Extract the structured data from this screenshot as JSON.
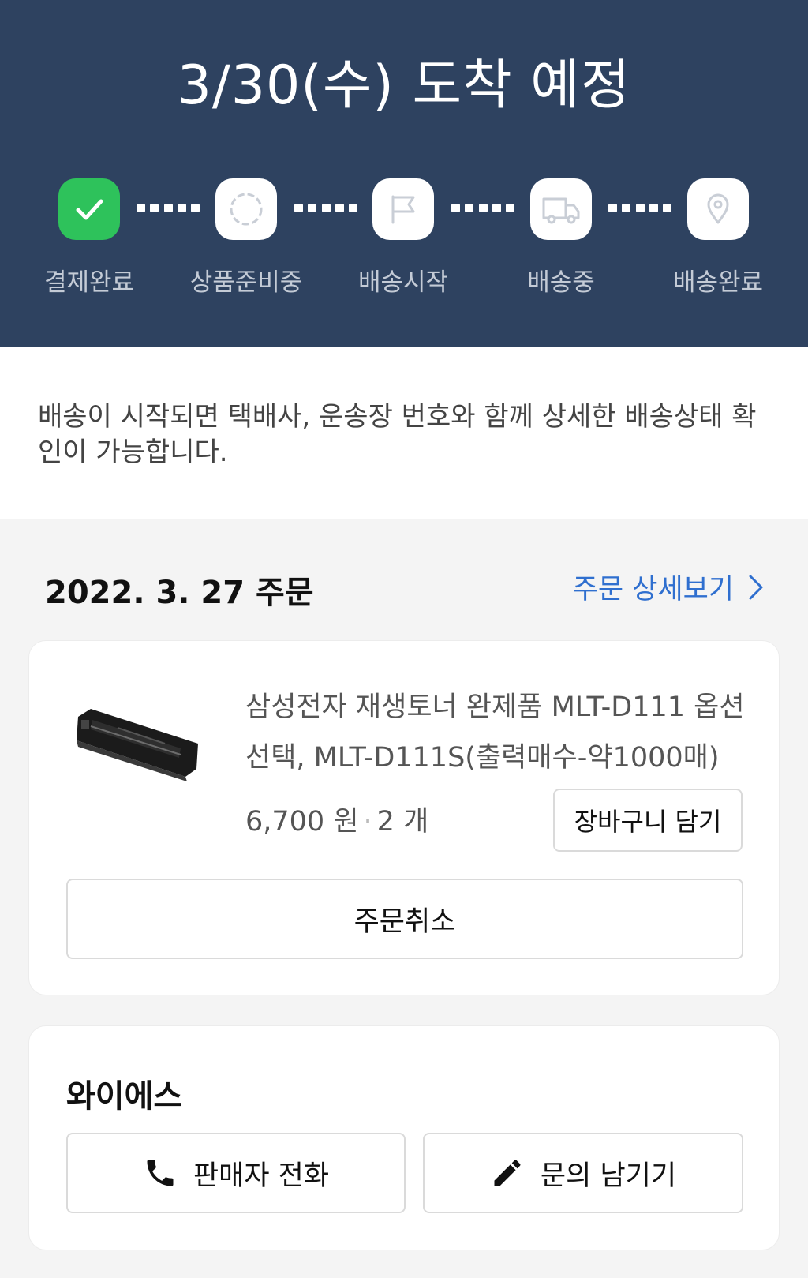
{
  "header": {
    "arrival_title": "3/30(수) 도착 예정",
    "steps": [
      {
        "label": "결제완료",
        "icon": "check-icon",
        "status": "done"
      },
      {
        "label": "상품준비중",
        "icon": "loading-circle-icon",
        "status": "pending"
      },
      {
        "label": "배송시작",
        "icon": "flag-icon",
        "status": "pending"
      },
      {
        "label": "배송중",
        "icon": "truck-icon",
        "status": "pending"
      },
      {
        "label": "배송완료",
        "icon": "location-pin-icon",
        "status": "pending"
      }
    ],
    "colors": {
      "background": "#2e4260",
      "done": "#2ec25b"
    }
  },
  "notice": {
    "text": "배송이 시작되면 택배사, 운송장 번호와 함께 상세한 배송상태 확인이 가능합니다."
  },
  "order": {
    "date_label": "2022. 3. 27 주문",
    "detail_link": "주문 상세보기",
    "link_color": "#2f6fcf",
    "product": {
      "name": "삼성전자 재생토너 완제품 MLT-D111 옵션선택, MLT-D111S(출력매수-약1000매)",
      "price": "6,700 원",
      "separator": "·",
      "quantity": "2 개",
      "image_icon": "toner-cartridge-image"
    },
    "cart_button": "장바구니 담기",
    "cancel_button": "주문취소"
  },
  "seller": {
    "name": "와이에스",
    "call_button": "판매자 전화",
    "call_icon": "phone-icon",
    "inquiry_button": "문의 남기기",
    "inquiry_icon": "pencil-icon"
  }
}
